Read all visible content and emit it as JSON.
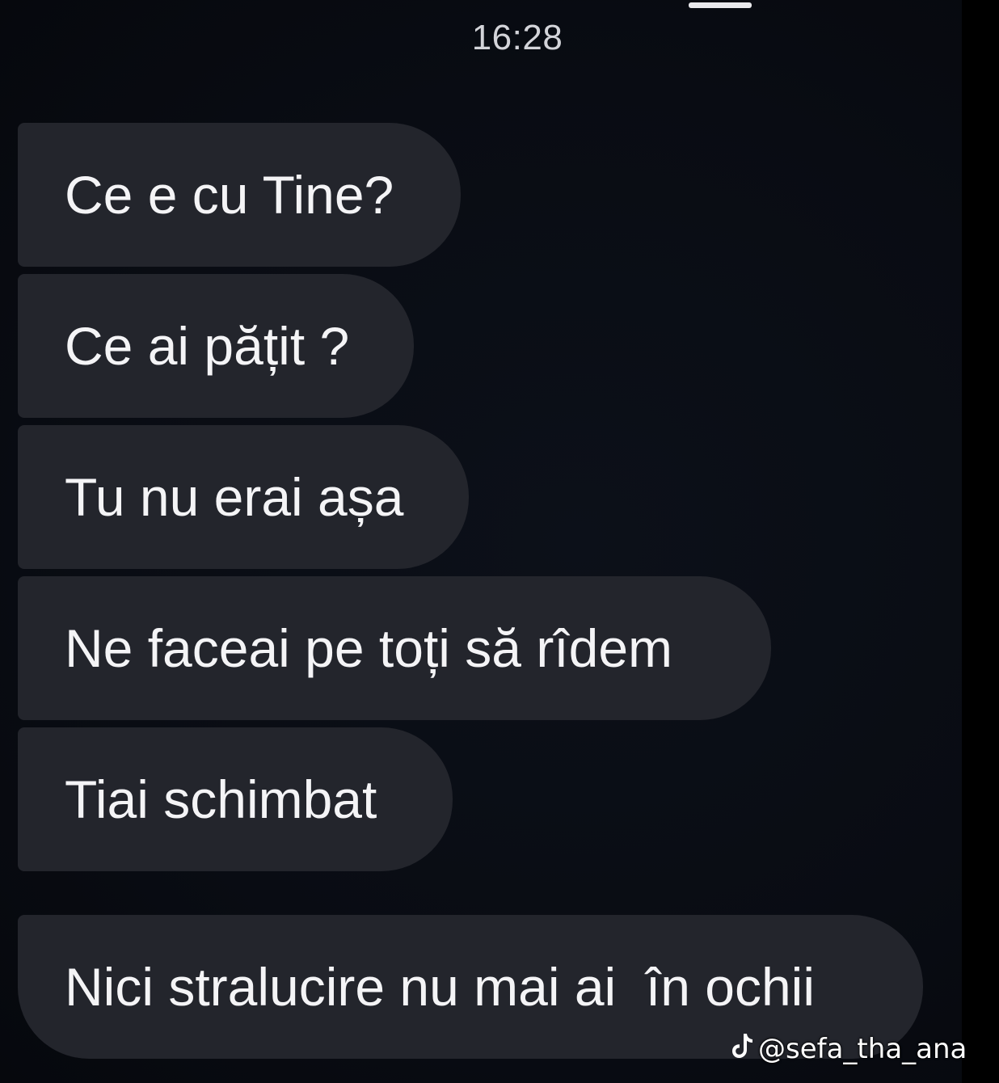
{
  "status": {
    "time": "16:28"
  },
  "messages": [
    {
      "text": "Ce e cu Tine?"
    },
    {
      "text": "Ce ai pățit ?"
    },
    {
      "text": "Tu nu erai așa"
    },
    {
      "text": "Ne faceai pe toți să rîdem"
    },
    {
      "text": "Tiai schimbat"
    },
    {
      "text": "Nici stralucire nu mai ai  în ochii"
    }
  ],
  "watermark": {
    "icon": "tiktok-icon",
    "handle": "@sefa_tha_ana"
  },
  "colors": {
    "background": "#090c13",
    "bubble": "#23252c",
    "text": "#f4f4f6"
  }
}
